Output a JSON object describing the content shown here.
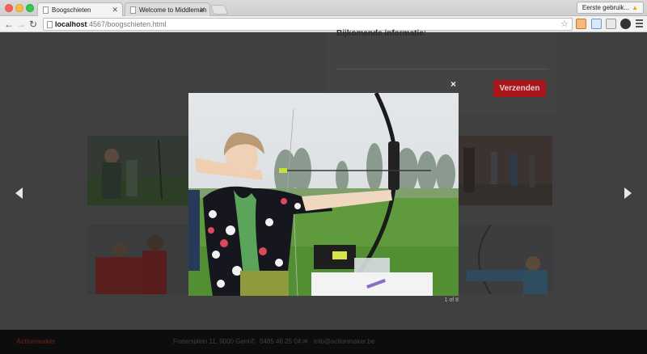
{
  "browser": {
    "tabs": [
      {
        "title": "Boogschieten",
        "active": true
      },
      {
        "title": "Welcome to Middleman",
        "active": false
      }
    ],
    "profile_label": "Eerste gebruik...",
    "url_host": "localhost",
    "url_rest": ":4567/boogschieten.html",
    "icons": {
      "back": "arrow-left-icon",
      "forward": "arrow-right-icon",
      "reload": "reload-icon",
      "bookmark": "star-icon",
      "menu": "hamburger-menu-icon"
    }
  },
  "page": {
    "form_heading": "Bijkomende informatie:",
    "submit_label": "Verzenden",
    "footer": {
      "brand": "Actionmaker",
      "address": "Fratersplein 11, 9000 Gent",
      "phone": "0485 46 25 04",
      "email": "info@actionmaker.be"
    }
  },
  "lightbox": {
    "close_label": "×",
    "counter": "1 of 8",
    "prev_icon": "chevron-left-icon",
    "next_icon": "chevron-right-icon"
  },
  "colors": {
    "accent_red": "#a8161c",
    "overlay": "#3a3a3a"
  }
}
